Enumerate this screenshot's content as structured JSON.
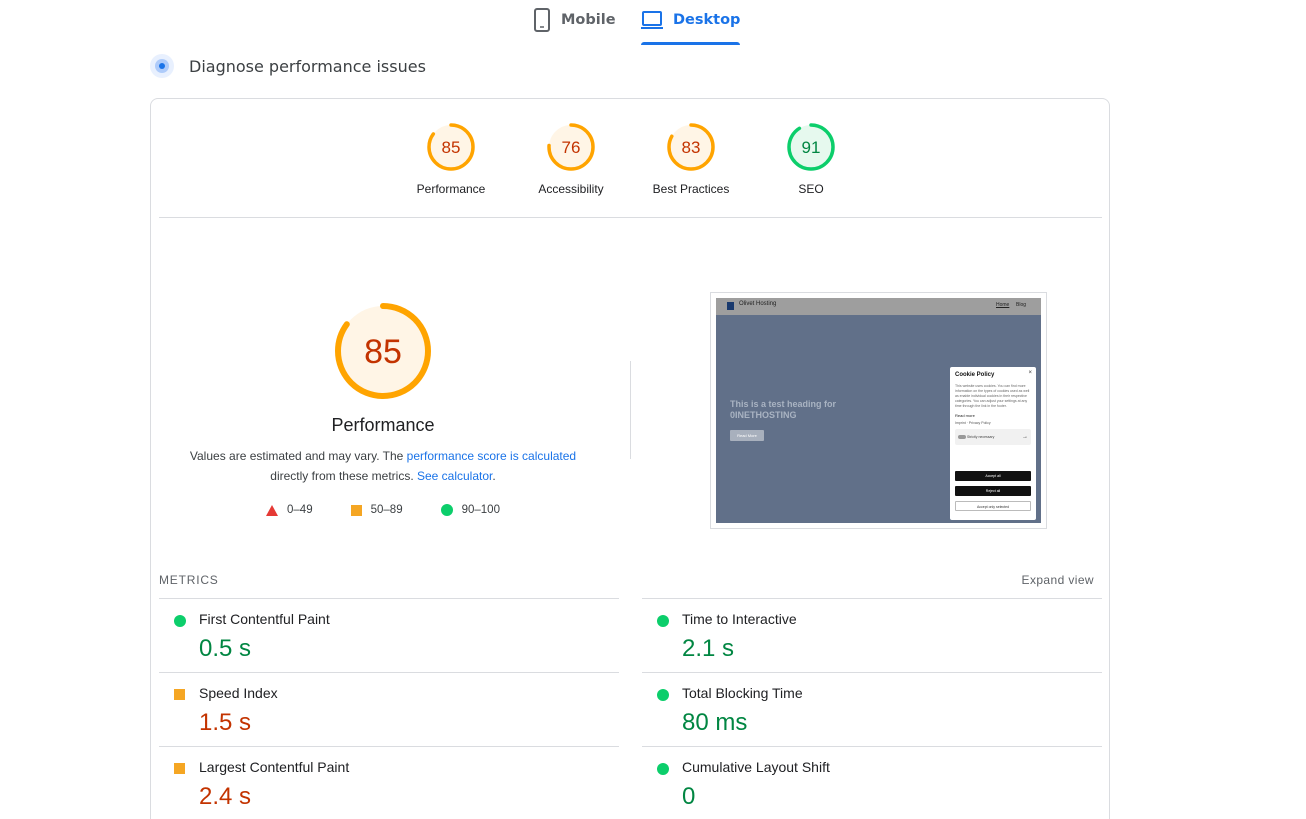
{
  "tabs": [
    {
      "label": "Mobile",
      "icon": "phone-icon",
      "active": false
    },
    {
      "label": "Desktop",
      "icon": "laptop-icon",
      "active": true
    }
  ],
  "diagnose": {
    "title": "Diagnose performance issues",
    "icon": "diagnose-icon"
  },
  "gauges": [
    {
      "label": "Performance",
      "score": "85",
      "value": 85,
      "rating": "average"
    },
    {
      "label": "Accessibility",
      "score": "76",
      "value": 76,
      "rating": "average"
    },
    {
      "label": "Best Practices",
      "score": "83",
      "value": 83,
      "rating": "average"
    },
    {
      "label": "SEO",
      "score": "91",
      "value": 91,
      "rating": "good"
    }
  ],
  "summary": {
    "score": "85",
    "value": 85,
    "title": "Performance",
    "desc_prefix": "Values are estimated and may vary. The ",
    "desc_link1": "performance score is calculated",
    "desc_mid": "directly from these metrics. ",
    "desc_link2": "See calculator",
    "desc_suffix": "."
  },
  "legend": [
    {
      "range": "0–49",
      "shape": "triangle"
    },
    {
      "range": "50–89",
      "shape": "square"
    },
    {
      "range": "90–100",
      "shape": "circle"
    }
  ],
  "screenshot": {
    "brand": "Olivet Hosting",
    "nav_home": "Home",
    "nav_blog": "Blog",
    "hero_line1": "This is a test heading for",
    "hero_line2": "0INETHOSTING",
    "hero_button": "Read More",
    "cookie_title": "Cookie Policy",
    "cookie_close": "×",
    "cookie_body": "This website uses cookies. You can find more information on the types of cookies used as well as enable individual cookies in their respective categories. You can adjust your settings at any time through the link in the footer.",
    "cookie_read_more": "Read more",
    "cookie_links": "Imprint · Privacy Policy",
    "cookie_strict": "Strictly necessary",
    "cookie_accept": "Accept all",
    "cookie_reject": "Reject all",
    "cookie_accept_selected": "Accept only selected"
  },
  "metrics": {
    "header": "METRICS",
    "expand": "Expand view",
    "items": [
      {
        "name": "First Contentful Paint",
        "value": "0.5 s",
        "rating": "good"
      },
      {
        "name": "Time to Interactive",
        "value": "2.1 s",
        "rating": "good"
      },
      {
        "name": "Speed Index",
        "value": "1.5 s",
        "rating": "average"
      },
      {
        "name": "Total Blocking Time",
        "value": "80 ms",
        "rating": "good"
      },
      {
        "name": "Largest Contentful Paint",
        "value": "2.4 s",
        "rating": "average"
      },
      {
        "name": "Cumulative Layout Shift",
        "value": "0",
        "rating": "good"
      }
    ]
  },
  "colors": {
    "accent": "#1a73e8",
    "good": "#0cce6b",
    "good_text": "#018642",
    "average": "#ffa400",
    "average_text": "#c33300",
    "poor": "#e53935"
  }
}
